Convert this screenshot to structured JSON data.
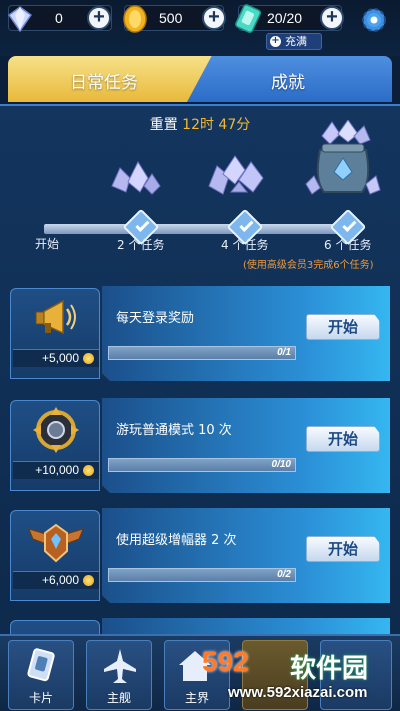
{
  "resources": {
    "gems": "0",
    "coins": "500",
    "energy": "20/20",
    "charge_full_label": "充满"
  },
  "tabs": {
    "daily": "日常任务",
    "achievements": "成就"
  },
  "reset": {
    "prefix": "重置",
    "time": "12时 47分"
  },
  "milestones": {
    "start": "开始",
    "labels": [
      "2 个任务",
      "4 个任务",
      "6 个任务"
    ],
    "note": "(使用高级会员3完成6个任务)"
  },
  "tasks": [
    {
      "title": "每天登录奖励",
      "reward": "+5,000",
      "progress": "0/1",
      "progress_fraction": 0,
      "button": "开始",
      "icon": "megaphone-icon"
    },
    {
      "title": "游玩普通模式 10 次",
      "reward": "+10,000",
      "progress": "0/10",
      "progress_fraction": 0,
      "button": "开始",
      "icon": "orb-icon"
    },
    {
      "title": "使用超级增幅器 2 次",
      "reward": "+6,000",
      "progress": "0/2",
      "progress_fraction": 0,
      "button": "开始",
      "icon": "wings-badge-icon"
    }
  ],
  "nav": {
    "cards": "卡片",
    "ship": "主舰",
    "home": "主界"
  },
  "watermark": {
    "brand": "592",
    "cn": "软件园",
    "url": "www.592xiazai.com"
  },
  "colors": {
    "accent_gold": "#f5b82e",
    "note_orange": "#f09a3a",
    "tab_active": "#e8b93a",
    "tab_inactive": "#2b6cc7"
  }
}
